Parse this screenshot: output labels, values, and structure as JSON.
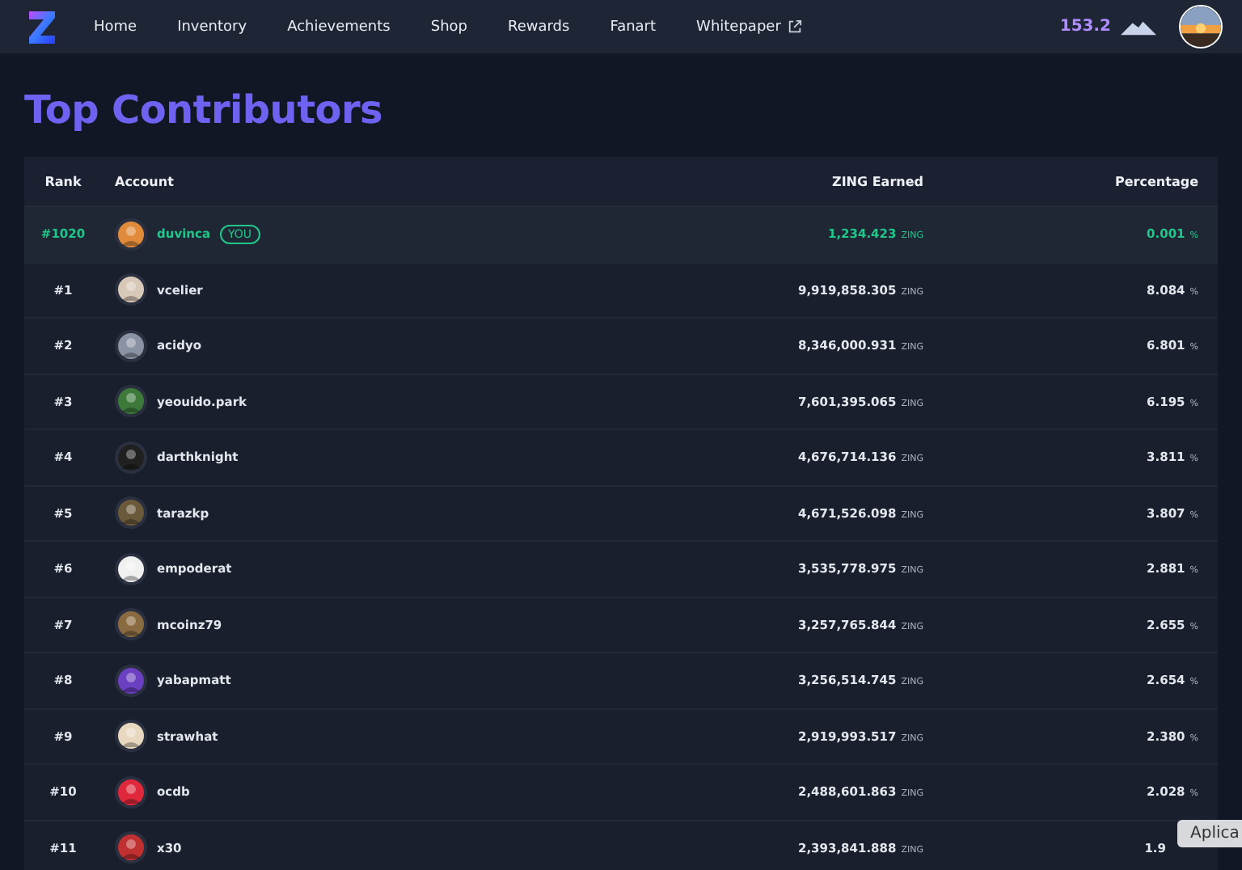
{
  "nav": {
    "items": [
      {
        "label": "Home",
        "external": false
      },
      {
        "label": "Inventory",
        "external": false
      },
      {
        "label": "Achievements",
        "external": false
      },
      {
        "label": "Shop",
        "external": false
      },
      {
        "label": "Rewards",
        "external": false
      },
      {
        "label": "Fanart",
        "external": false
      },
      {
        "label": "Whitepaper",
        "external": true
      }
    ],
    "balance": "153.2"
  },
  "title": "Top Contributors",
  "table": {
    "columns": [
      "Rank",
      "Account",
      "ZING Earned",
      "Percentage"
    ],
    "rows": [
      {
        "rank": "#1020",
        "account": "duvinca",
        "badge": "YOU",
        "highlighted": true,
        "zing": "1,234.423",
        "zing_unit": "ZING",
        "percentage": "0.001",
        "percentage_unit": "%",
        "color": "#e08a3c"
      },
      {
        "rank": "#1",
        "account": "vcelier",
        "highlighted": false,
        "zing": "9,919,858.305",
        "zing_unit": "ZING",
        "percentage": "8.084",
        "percentage_unit": "%",
        "color": "#d8c8b8"
      },
      {
        "rank": "#2",
        "account": "acidyo",
        "highlighted": false,
        "zing": "8,346,000.931",
        "zing_unit": "ZING",
        "percentage": "6.801",
        "percentage_unit": "%",
        "color": "#8a93a3"
      },
      {
        "rank": "#3",
        "account": "yeouido.park",
        "highlighted": false,
        "zing": "7,601,395.065",
        "zing_unit": "ZING",
        "percentage": "6.195",
        "percentage_unit": "%",
        "color": "#3d7a3a"
      },
      {
        "rank": "#4",
        "account": "darthknight",
        "highlighted": false,
        "zing": "4,676,714.136",
        "zing_unit": "ZING",
        "percentage": "3.811",
        "percentage_unit": "%",
        "color": "#202020"
      },
      {
        "rank": "#5",
        "account": "tarazkp",
        "highlighted": false,
        "zing": "4,671,526.098",
        "zing_unit": "ZING",
        "percentage": "3.807",
        "percentage_unit": "%",
        "color": "#6b5a3a"
      },
      {
        "rank": "#6",
        "account": "empoderat",
        "highlighted": false,
        "zing": "3,535,778.975",
        "zing_unit": "ZING",
        "percentage": "2.881",
        "percentage_unit": "%",
        "color": "#f0f0f0"
      },
      {
        "rank": "#7",
        "account": "mcoinz79",
        "highlighted": false,
        "zing": "3,257,765.844",
        "zing_unit": "ZING",
        "percentage": "2.655",
        "percentage_unit": "%",
        "color": "#8a6a40"
      },
      {
        "rank": "#8",
        "account": "yabapmatt",
        "highlighted": false,
        "zing": "3,256,514.745",
        "zing_unit": "ZING",
        "percentage": "2.654",
        "percentage_unit": "%",
        "color": "#6a3fc0"
      },
      {
        "rank": "#9",
        "account": "strawhat",
        "highlighted": false,
        "zing": "2,919,993.517",
        "zing_unit": "ZING",
        "percentage": "2.380",
        "percentage_unit": "%",
        "color": "#e8d8c0"
      },
      {
        "rank": "#10",
        "account": "ocdb",
        "highlighted": false,
        "zing": "2,488,601.863",
        "zing_unit": "ZING",
        "percentage": "2.028",
        "percentage_unit": "%",
        "color": "#e0283c"
      },
      {
        "rank": "#11",
        "account": "x30",
        "highlighted": false,
        "zing": "2,393,841.888",
        "zing_unit": "ZING",
        "percentage": "1.9",
        "color": "#c03030"
      }
    ]
  },
  "tooltip": "Aplica"
}
